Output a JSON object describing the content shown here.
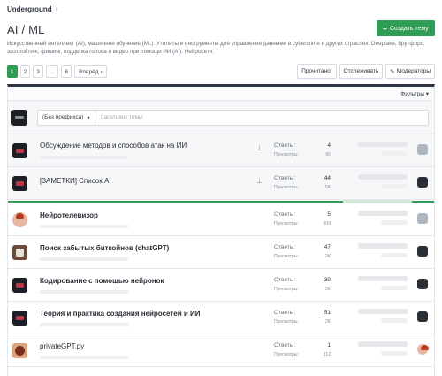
{
  "breadcrumb": {
    "section": "Underground",
    "separator": "›"
  },
  "page": {
    "title": "AI / ML",
    "description": "Искусственный интеллект (AI), машинное обучение (ML). Утилиты и инструменты для управления данными в cybercrime и других отраслях. Deepfake, брутфорс, эксплойтинг, фишинг, подделка голоса и видео при помощи ИИ (AI). Нейросети."
  },
  "create_button": {
    "label": "Создать тему",
    "icon": "plus-icon"
  },
  "pagination": {
    "pages": [
      "1",
      "2",
      "3",
      "…",
      "6"
    ],
    "active": "1",
    "next_label": "Вперёд",
    "next_icon": "chevron-right-icon"
  },
  "actions": {
    "read": "Прочитано!",
    "watch": "Отслеживать",
    "moderators": "Модераторы"
  },
  "filters": {
    "label": "Фильтры",
    "icon": "caret-down-icon"
  },
  "new_thread": {
    "prefix": "(Без префикса)",
    "title_placeholder": "Заголовок темы"
  },
  "colors": {
    "accent": "#2f9d53",
    "panel_top": "#2e3546"
  },
  "sticky_threads": [
    {
      "title": "Обсуждение методов и способов атак на ИИ",
      "replies_label": "Ответы:",
      "replies": "4",
      "views_label": "Просмотры:",
      "views": "60"
    },
    {
      "title": "[ЗАМЕТКИ] Список AI",
      "replies_label": "Ответы:",
      "replies": "44",
      "views_label": "Просмотры:",
      "views": "5K"
    }
  ],
  "threads": [
    {
      "title": "Нейротелевизор",
      "replies_label": "Ответы:",
      "replies": "5",
      "views_label": "Просмотры:",
      "views": "609"
    },
    {
      "title": "Поиск забытых биткойнов (chatGPT)",
      "replies_label": "Ответы:",
      "replies": "47",
      "views_label": "Просмотры:",
      "views": "3K"
    },
    {
      "title": "Кодирование с помощью нейронок",
      "replies_label": "Ответы:",
      "replies": "30",
      "views_label": "Просмотры:",
      "views": "3K"
    },
    {
      "title": "Теория и практика создания нейросетей и ИИ",
      "replies_label": "Ответы:",
      "replies": "51",
      "views_label": "Просмотры:",
      "views": "2K"
    },
    {
      "title": "privateGPT.py",
      "replies_label": "Ответы:",
      "replies": "1",
      "views_label": "Просмотры:",
      "views": "312"
    }
  ]
}
